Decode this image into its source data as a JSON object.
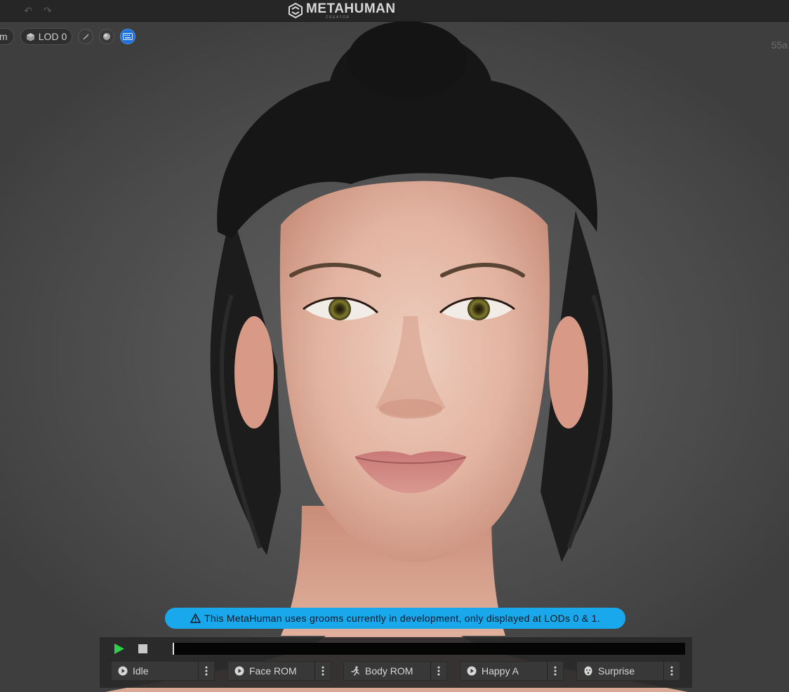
{
  "topbar": {
    "undo_icon": "undo-icon",
    "redo_icon": "redo-icon",
    "logo_title": "METAHUMAN",
    "logo_subtitle": "CREATOR"
  },
  "viewport_toolbar": {
    "camera_label": "m",
    "lod_label": "LOD 0",
    "icons": [
      "lod-cube-icon",
      "brush-icon",
      "sphere-icon",
      "keyboard-icon"
    ],
    "active_color": "#1e6fd9"
  },
  "fps_label": "55a",
  "banner": {
    "text": "This MetaHuman uses grooms currently in development, only displayed at LODs 0 & 1.",
    "icon": "warning-icon",
    "color": "#19a8ec"
  },
  "timeline": {
    "progress": 0.0,
    "play_icon": "play-icon",
    "stop_icon": "stop-icon",
    "play_color": "#2fcf4a",
    "animations": [
      {
        "label": "Idle",
        "icon": "play-circle-icon"
      },
      {
        "label": "Face ROM",
        "icon": "play-circle-icon"
      },
      {
        "label": "Body ROM",
        "icon": "running-figure-icon"
      },
      {
        "label": "Happy A",
        "icon": "play-circle-icon"
      },
      {
        "label": "Surprise",
        "icon": "face-icon"
      }
    ]
  }
}
